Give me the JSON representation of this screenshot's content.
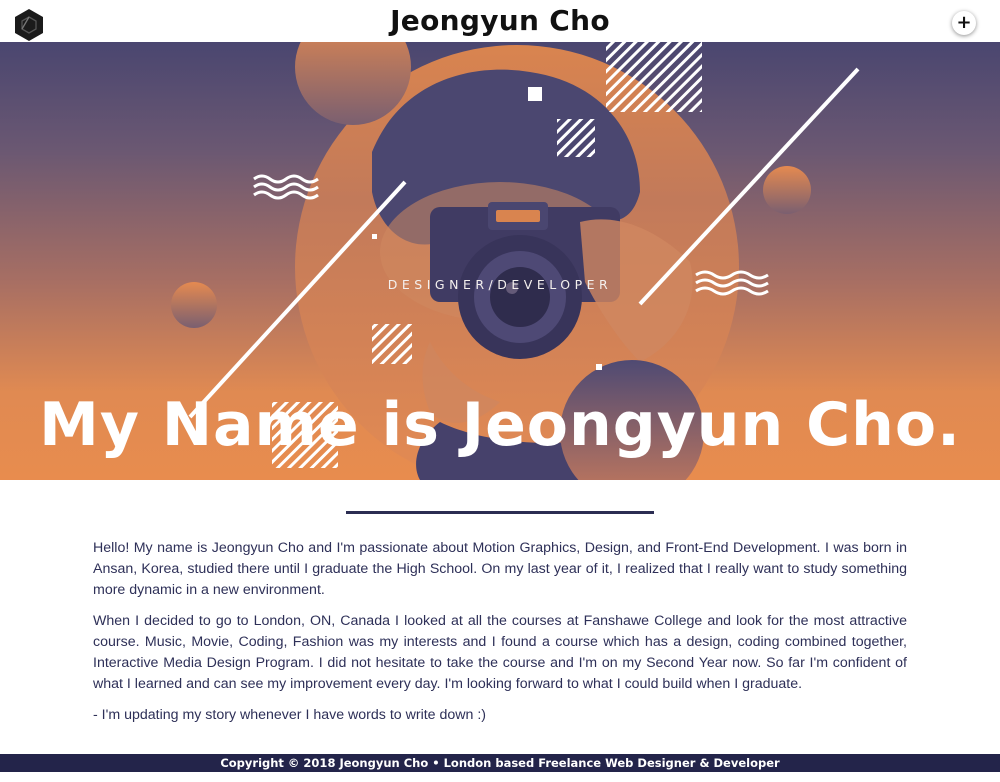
{
  "header": {
    "title": "Jeongyun Cho",
    "logo_icon": "cube-logo-icon",
    "menu_icon": "plus-icon",
    "menu_label": "+"
  },
  "hero": {
    "subtitle": "DESIGNER/DEVELOPER",
    "title": "My Name is Jeongyun Cho."
  },
  "about": {
    "paragraphs": [
      "Hello! My name is Jeongyun Cho and I'm passionate about Motion Graphics, Design, and Front-End Development. I was born in Ansan, Korea, studied there until I graduate the High School. On my last year of it, I realized that I really want to study something more dynamic in a new environment.",
      "When I decided to go to London, ON, Canada I looked at all the courses at Fanshawe College and look for the most attractive course. Music, Movie, Coding, Fashion was my interests and I found a course which has a design, coding combined together, Interactive Media Design Program. I did not hesitate to take the course and I'm on my Second Year now. So far I'm confident of what I learned and can see my improvement every day. I'm looking forward to what I could build when I graduate.",
      "- I'm updating my story whenever I have words to write down :)"
    ]
  },
  "footer": {
    "text": "Copyright © 2018 Jeongyun Cho • London based Freelance Web Designer & Developer"
  },
  "colors": {
    "navy": "#23244a",
    "orange": "#e88c4e",
    "purple": "#4a4670"
  }
}
